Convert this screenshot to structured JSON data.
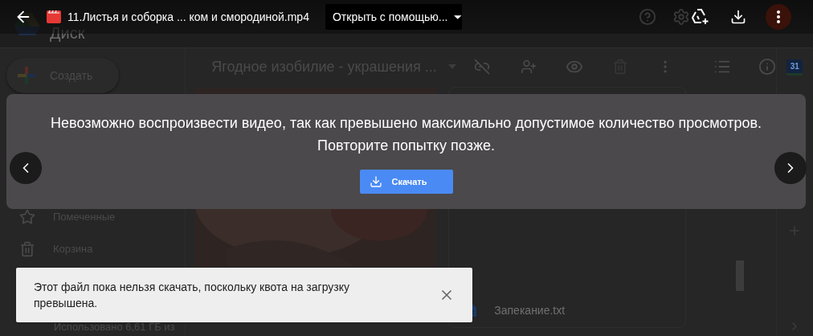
{
  "top_bar": {
    "file_name": "11.Листья и соборка ... ком и смородиной.mp4",
    "open_with": "Открыть с помощью..."
  },
  "drive": {
    "app_name": "Диск",
    "create_button": "Создать",
    "folder_title": "Ягодное изобилие - украшения ...",
    "nav_items": [
      {
        "label": "Помеченные",
        "kind": "starred"
      },
      {
        "label": "Корзина",
        "kind": "trash"
      }
    ],
    "storage": "Использовано 6,61 ГБ из",
    "file_name": "Запекание.txt",
    "calendar_day": "31"
  },
  "player_error": {
    "lines": [
      "Невозможно воспроизвести видео, так как превышено максимально допустимое количество просмотров.",
      "Повторите попытку позже."
    ],
    "download_button": "Скачать"
  },
  "toast": {
    "message": "Этот файл пока нельзя скачать, поскольку квота на загрузку превышена."
  }
}
